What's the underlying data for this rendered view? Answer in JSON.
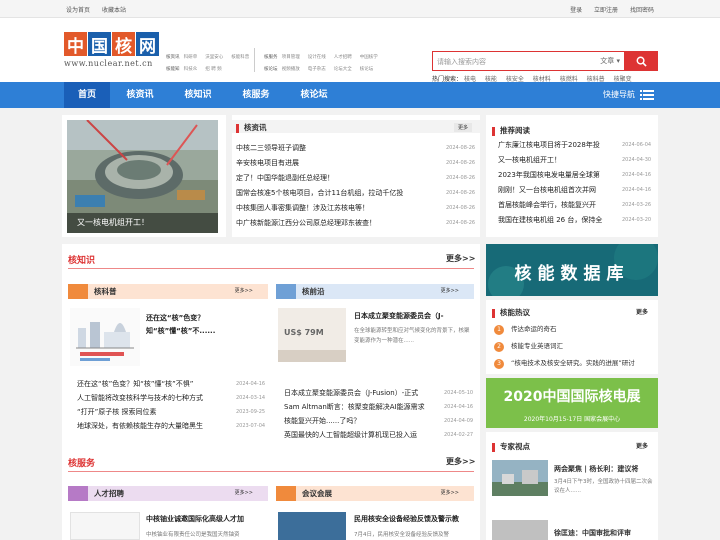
{
  "topbar": {
    "left": [
      "设为首页",
      "收藏本站"
    ],
    "right": [
      "登录",
      "立即注册",
      "找回密码"
    ]
  },
  "logo": {
    "chars": [
      "中",
      "国",
      "核",
      "网"
    ],
    "url": "www.nuclear.net.cn"
  },
  "header_nav": {
    "row1": [
      "核资讯",
      "科研单",
      "沃里安心",
      "核能科普"
    ],
    "row2": [
      "核能知",
      "科技众",
      "招 聘 频"
    ],
    "row3": [
      "核服务",
      "项目管理",
      "设计在线",
      "人才招聘",
      "中国核学"
    ],
    "row4": [
      "核论坛",
      "视频播放",
      "电子杂志",
      "论坛大全",
      "核论坛"
    ]
  },
  "search": {
    "placeholder": "请输入搜索内容",
    "select": "文章"
  },
  "hot": {
    "label": "热门搜索：",
    "items": [
      "核电",
      "核能",
      "核安全",
      "核材料",
      "核燃料",
      "核科普",
      "核聚变"
    ]
  },
  "nav": {
    "items": [
      "首页",
      "核资讯",
      "核知识",
      "核服务",
      "核论坛"
    ],
    "quick": "快捷导航"
  },
  "hero": {
    "caption": "又一核电机组开工！"
  },
  "news": {
    "title": "核资讯",
    "more": "更多",
    "items": [
      {
        "t": "中核二三领导班子调整",
        "d": "2024-08-26"
      },
      {
        "t": "辛安核电项目有进展",
        "d": "2024-08-26"
      },
      {
        "t": "定了！中国华能退副任总经理！",
        "d": "2024-08-26"
      },
      {
        "t": "国常会核准5个核电项目，合计11台机组，拉动千亿投",
        "d": "2024-08-26"
      },
      {
        "t": "中核集团人事密集调整！涉及江苏核电等！",
        "d": "2024-08-26"
      },
      {
        "t": "中广核新能源江西分公司原总经理邓东被查！",
        "d": "2024-08-26"
      }
    ]
  },
  "recommend": {
    "title": "推荐阅读",
    "items": [
      {
        "t": "广东廉江核电项目将于2028年投",
        "d": "2024-06-04"
      },
      {
        "t": "又一核电机组开工！",
        "d": "2024-04-30"
      },
      {
        "t": "2023年我国核电发电量居全球第",
        "d": "2024-04-16"
      },
      {
        "t": "刚刚！又一台核电机组首次并网",
        "d": "2024-04-16"
      },
      {
        "t": "首届核能峰会举行，核能复兴开",
        "d": "2024-03-26"
      },
      {
        "t": "我国在建核电机组 26 台，保持全",
        "d": "2024-03-20"
      }
    ]
  },
  "knowledge": {
    "title": "核知识",
    "more": "更多>>",
    "kepu": {
      "title": "核科普",
      "more": "更多>>",
      "feature": "还在这“核”色变？知“核”懂“核”不......",
      "items": [
        {
          "t": "还在这“核”色变？知“核”懂“核”不惧”",
          "d": "2024-04-16"
        },
        {
          "t": "人工智能将改变核科学与技术的七种方式",
          "d": "2024-03-14"
        },
        {
          "t": "“打开”原子核 探索同位素",
          "d": "2023-09-25"
        },
        {
          "t": "地球深处，有依赖核能生存的大量暗黑生",
          "d": "2023-07-04"
        }
      ]
    },
    "qianyan": {
      "title": "核前沿",
      "more": "更多>>",
      "feature_title": "日本成立聚变能源委员会（J-",
      "feature_desc": "在全球能源转型和应对气候变化的背景下，核聚变能源作为一种潜在......",
      "img_text": "US$ 79M",
      "items": [
        {
          "t": "日本成立聚变能源委员会（J-Fusion）-正式",
          "d": "2024-05-10"
        },
        {
          "t": "Sam Altman断言：核聚变能解决AI能源需求",
          "d": "2024-04-16"
        },
        {
          "t": "核能复兴开始......了吗？",
          "d": "2024-04-09"
        },
        {
          "t": "英国最快的人工智能超级计算机现已投入运",
          "d": "2024-02-27"
        }
      ]
    }
  },
  "service": {
    "title": "核服务",
    "more": "更多>>",
    "rencai": {
      "title": "人才招聘",
      "more": "更多>>",
      "feature_title": "中核铀业诚邀国际化高级人才加",
      "feature_desc": "中核铀业有限责任公司是我国天然铀资"
    },
    "huiyi": {
      "title": "会议会展",
      "more": "更多>>",
      "feature_title": "民用核安全设备经验反馈及警示教",
      "feature_desc": "7月4日，民用核安全设备经验反馈及警"
    }
  },
  "databank": {
    "text": "核能数据库"
  },
  "hot_topics": {
    "title": "核能热议",
    "more": "更多",
    "items": [
      "传达命运的奇石",
      "核能专业英语词汇",
      "“核电技术及核安全研究。实践的进展”研讨"
    ]
  },
  "expo": {
    "title": "2020中国国际核电展",
    "sub": "2020年10月15-17日  国家会展中心"
  },
  "expert": {
    "title": "专家视点",
    "more": "更多",
    "items": [
      {
        "t": "两会聚焦 | 杨长利：建议将",
        "d": "3月4日下午3时，全国政协十四届二次会议在人......"
      },
      {
        "t": "徐匡迪：中国审批和评审",
        "d": ""
      }
    ]
  },
  "colors": {
    "accent": "#d33333",
    "nav": "#2e7fd6",
    "orange": "#f08a3c"
  }
}
